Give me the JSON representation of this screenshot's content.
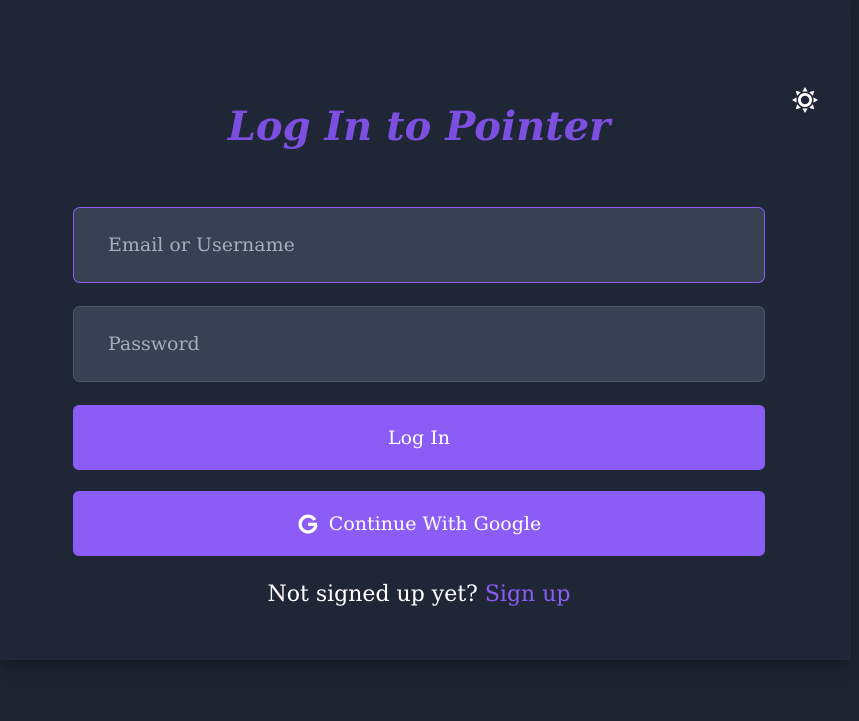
{
  "page": {
    "title": "Log In to Pointer",
    "theme_toggle_icon": "sun-icon"
  },
  "form": {
    "email_placeholder": "Email or Username",
    "email_value": "",
    "password_placeholder": "Password",
    "password_value": "",
    "login_label": "Log In",
    "google_label": "Continue With Google",
    "google_icon": "google-icon"
  },
  "footer": {
    "prompt": "Not signed up yet?",
    "signup_label": "Sign up"
  },
  "colors": {
    "background": "#1f2736",
    "accent": "#8b5cf6",
    "title": "#7c4fe0",
    "input_bg": "#374151"
  }
}
